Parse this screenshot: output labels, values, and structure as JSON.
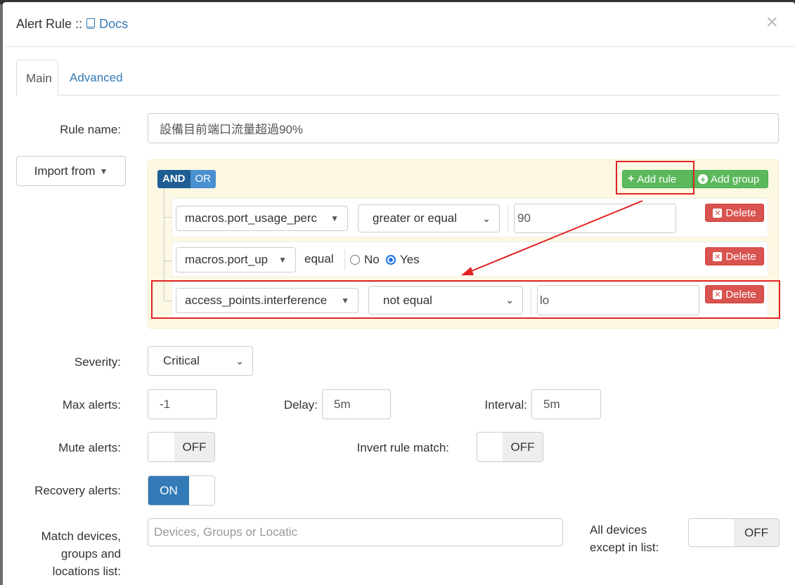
{
  "modal": {
    "title_prefix": "Alert Rule ::",
    "docs_icon": "book-icon",
    "docs_label": "Docs",
    "close_glyph": "×"
  },
  "tabs": [
    {
      "label": "Main",
      "active": true
    },
    {
      "label": "Advanced",
      "active": false
    }
  ],
  "form": {
    "rule_name_label": "Rule name:",
    "rule_name_value": "設備目前端口流量超過90%",
    "import_label": "Import from",
    "severity_label": "Severity:",
    "severity_value": "Critical",
    "max_alerts_label": "Max alerts:",
    "max_alerts_value": "-1",
    "delay_label": "Delay:",
    "delay_value": "5m",
    "interval_label": "Interval:",
    "interval_value": "5m",
    "mute_label": "Mute alerts:",
    "mute_state": "OFF",
    "invert_label": "Invert rule match:",
    "invert_state": "OFF",
    "recovery_label": "Recovery alerts:",
    "recovery_state": "ON",
    "match_label_1": "Match devices,",
    "match_label_2": "groups and",
    "match_label_3": "locations list:",
    "match_placeholder": "Devices, Groups or Locatic",
    "all_devices_label_1": "All devices",
    "all_devices_label_2": "except in list:",
    "all_devices_state": "OFF"
  },
  "builder": {
    "and_label": "AND",
    "or_label": "OR",
    "add_rule_label": "Add rule",
    "add_group_label": "Add group",
    "delete_label": "Delete",
    "rules": [
      {
        "field": "macros.port_usage_perc",
        "operator": "greater or equal",
        "value": "90"
      },
      {
        "field": "macros.port_up",
        "operator": "equal",
        "radio_no": "No",
        "radio_yes": "Yes",
        "selected": "Yes"
      },
      {
        "field": "access_points.interference",
        "operator": "not equal",
        "value": "lo"
      }
    ]
  },
  "colors": {
    "accent": "#337ab7",
    "success": "#5cb85c",
    "danger": "#d9534f",
    "annotation": "#e02424"
  }
}
